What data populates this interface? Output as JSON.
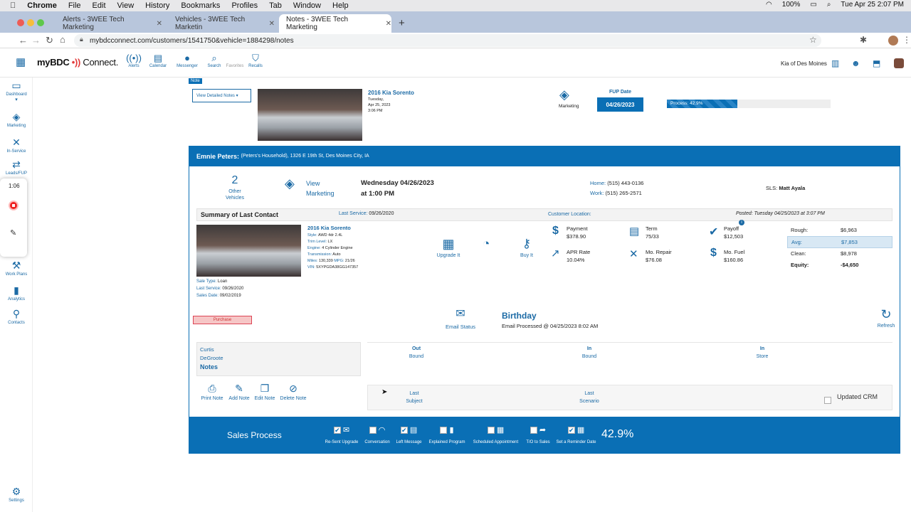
{
  "menubar": {
    "app": "Chrome",
    "items": [
      "File",
      "Edit",
      "View",
      "History",
      "Bookmarks",
      "Profiles",
      "Tab",
      "Window",
      "Help"
    ],
    "battery": "100%",
    "datetime": "Tue Apr 25  2:07 PM"
  },
  "tabs": [
    {
      "label": "Alerts - 3WEE Tech Marketing"
    },
    {
      "label": "Vehicles - 3WEE Tech Marketin"
    },
    {
      "label": "Notes - 3WEE Tech Marketing"
    }
  ],
  "url": "mybdcconnect.com/customers/1541750&vehicle=1884298/notes",
  "brand": {
    "name": "myBDC",
    "name2": "Connect."
  },
  "topnav": [
    {
      "label": "Alerts"
    },
    {
      "label": "Calendar"
    },
    {
      "label": "Messenger"
    },
    {
      "label": "Search"
    },
    {
      "label": "Favorites"
    },
    {
      "label": "Recalls"
    }
  ],
  "dealer": "Kia of Des Moines",
  "sidebar": [
    {
      "label": "Dashboard"
    },
    {
      "label": "Marketing"
    },
    {
      "label": "In-Service"
    },
    {
      "label": "Leads/FUP"
    },
    {
      "label": "Work Plans"
    },
    {
      "label": "Analytics"
    },
    {
      "label": "Contacts"
    },
    {
      "label": "Settings"
    }
  ],
  "recorder": {
    "time": "1:06"
  },
  "note_tag": "Note",
  "top_card": {
    "button": "View Detailed Notes ▾",
    "vehicle": "2016 Kia Sorento",
    "day": "Tuesday,",
    "date": "Apr 25, 2023",
    "time": "3:06 PM",
    "marketing": "Marketing",
    "fup_label": "FUP Date",
    "fup_date": "04/26/2023",
    "process_label": "Process: 42.9%",
    "process_pct": 42.9
  },
  "customer": {
    "name": "Emnie Peters:",
    "detail": "(Peters's Household), 1326 E 19th St, Des Moines City, IA"
  },
  "info": {
    "other_count": "2",
    "other_label1": "Other",
    "other_label2": "Vehicles",
    "view_label1": "View",
    "view_label2": "Marketing",
    "appt_date": "Wednesday 04/26/2023",
    "appt_time": "at 1:00 PM",
    "home_label": "Home:",
    "home": "(515) 443-0136",
    "work_label": "Work:",
    "work": "(515) 265-2571",
    "sls_label": "SLS:",
    "sls": "Matt Ayala"
  },
  "summary": {
    "title": "Summary of Last Contact",
    "last_service_label": "Last Service:",
    "last_service": "09/26/2020",
    "location_label": "Customer Location:",
    "posted": "Posted: Tuesday 04/25/2023 at 3:07 PM"
  },
  "vehicle": {
    "title": "2016 Kia Sorento",
    "specs": [
      {
        "k": "Style:",
        "v": "AWD 4dr 2.4L"
      },
      {
        "k": "Trim Level:",
        "v": "LX"
      },
      {
        "k": "Engine:",
        "v": "4 Cylinder Engine"
      },
      {
        "k": "Transmission:",
        "v": "Auto"
      }
    ],
    "miles_k": "Miles:",
    "miles": "130,339",
    "mpg_k": "MPG:",
    "mpg": "21/26",
    "vin_k": "VIN:",
    "vin": "5XYPGDA38GG147357",
    "sale_type_k": "Sale Type:",
    "sale_type": "Loan",
    "last_service_k": "Last Service:",
    "last_service": "09/26/2020",
    "sales_date_k": "Sales Date:",
    "sales_date": "09/02/2019"
  },
  "actions": {
    "upgrade": "Upgrade It",
    "buy": "Buy It"
  },
  "finance": [
    {
      "label": "Payment",
      "value": "$378.90"
    },
    {
      "label": "Term",
      "value": "75/33"
    },
    {
      "label": "Payoff",
      "value": "$12,503"
    },
    {
      "label": "APR Rate",
      "value": "10.04%"
    },
    {
      "label": "Mo. Repair",
      "value": "$76.08"
    },
    {
      "label": "Mo. Fuel",
      "value": "$160.86"
    }
  ],
  "valuation": [
    {
      "label": "Rough:",
      "value": "$6,963"
    },
    {
      "label": "Avg:",
      "value": "$7,853"
    },
    {
      "label": "Clean:",
      "value": "$8,978"
    },
    {
      "label": "Equity:",
      "value": "-$4,650"
    }
  ],
  "purchase": "Purchase",
  "email": {
    "label": "Email Status",
    "title": "Birthday",
    "detail": "Email Processed @ 04/25/2023 8:02 AM",
    "refresh": "Refresh"
  },
  "contact": {
    "first": "Curtis",
    "last": "DeGroote",
    "notes": "Notes"
  },
  "bound": [
    {
      "a": "Out",
      "b": "Bound"
    },
    {
      "a": "In",
      "b": "Bound"
    },
    {
      "a": "In",
      "b": "Store"
    }
  ],
  "note_actions": [
    {
      "label": "Print Note"
    },
    {
      "label": "Add Note"
    },
    {
      "label": "Edit Note"
    },
    {
      "label": "Delete Note"
    }
  ],
  "last": [
    {
      "a": "Last",
      "b": "Subject"
    },
    {
      "a": "Last",
      "b": "Scenario"
    }
  ],
  "updated_crm": "Updated CRM",
  "sales": {
    "title": "Sales Process",
    "pct": "42.9%",
    "steps": [
      {
        "label": "Re-Sent Upgrade",
        "checked": true
      },
      {
        "label": "Conversation",
        "checked": false
      },
      {
        "label": "Left Message",
        "checked": true
      },
      {
        "label": "Explained Program",
        "checked": false
      },
      {
        "label": "Scheduled Appointment",
        "checked": false
      },
      {
        "label": "T/O to Sales",
        "checked": false
      },
      {
        "label": "Set a Reminder Date",
        "checked": true
      }
    ]
  }
}
